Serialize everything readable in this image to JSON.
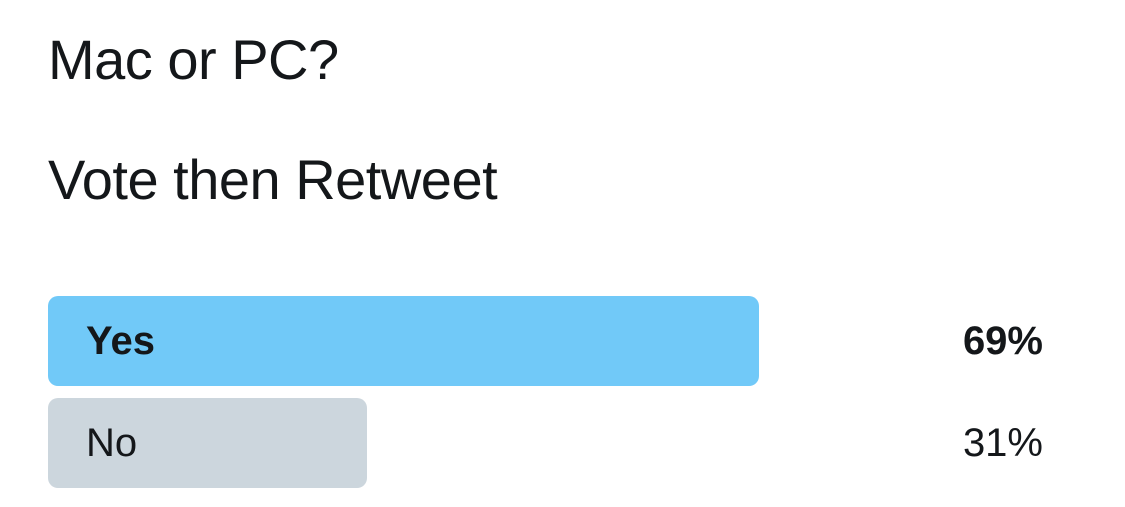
{
  "tweet": {
    "lines": [
      "Mac or PC?",
      "Vote then Retweet"
    ]
  },
  "poll": {
    "options": [
      {
        "label": "Yes",
        "percent_text": "69%",
        "percent": 69,
        "winner": true,
        "bar_color": "#71c9f8"
      },
      {
        "label": "No",
        "percent_text": "31%",
        "percent": 31,
        "winner": false,
        "bar_color": "#ccd6dd"
      }
    ]
  }
}
